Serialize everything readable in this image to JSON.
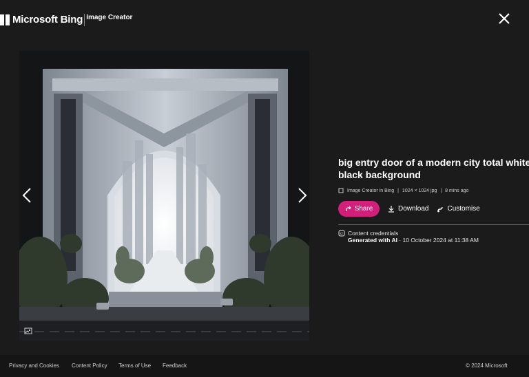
{
  "header": {
    "brand": "Microsoft Bing",
    "product": "Image Creator"
  },
  "image": {
    "title_line1": "big entry door of a modern city total white in",
    "title_line2": "black background",
    "source": "Image Creator in Bing",
    "resolution": "1024 × 1024 jpg",
    "age": "8 mins ago"
  },
  "actions": {
    "share": "Share",
    "download": "Download",
    "customise": "Customise"
  },
  "credentials": {
    "label": "Content credentials",
    "generated": "Generated with AI",
    "date": " · 10 October 2024 at 11:38 AM"
  },
  "footer": {
    "links": [
      "Privacy and Cookies",
      "Content Policy",
      "Terms of Use",
      "Feedback"
    ],
    "copyright": "© 2024 Microsoft"
  },
  "colors": {
    "background": "#1b1b1b",
    "accent_share": "#d11f7a"
  },
  "icons": [
    "close-icon",
    "chevron-left-icon",
    "chevron-right-icon",
    "share-icon",
    "download-icon",
    "customise-icon",
    "content-credentials-icon",
    "visual-search-icon"
  ]
}
